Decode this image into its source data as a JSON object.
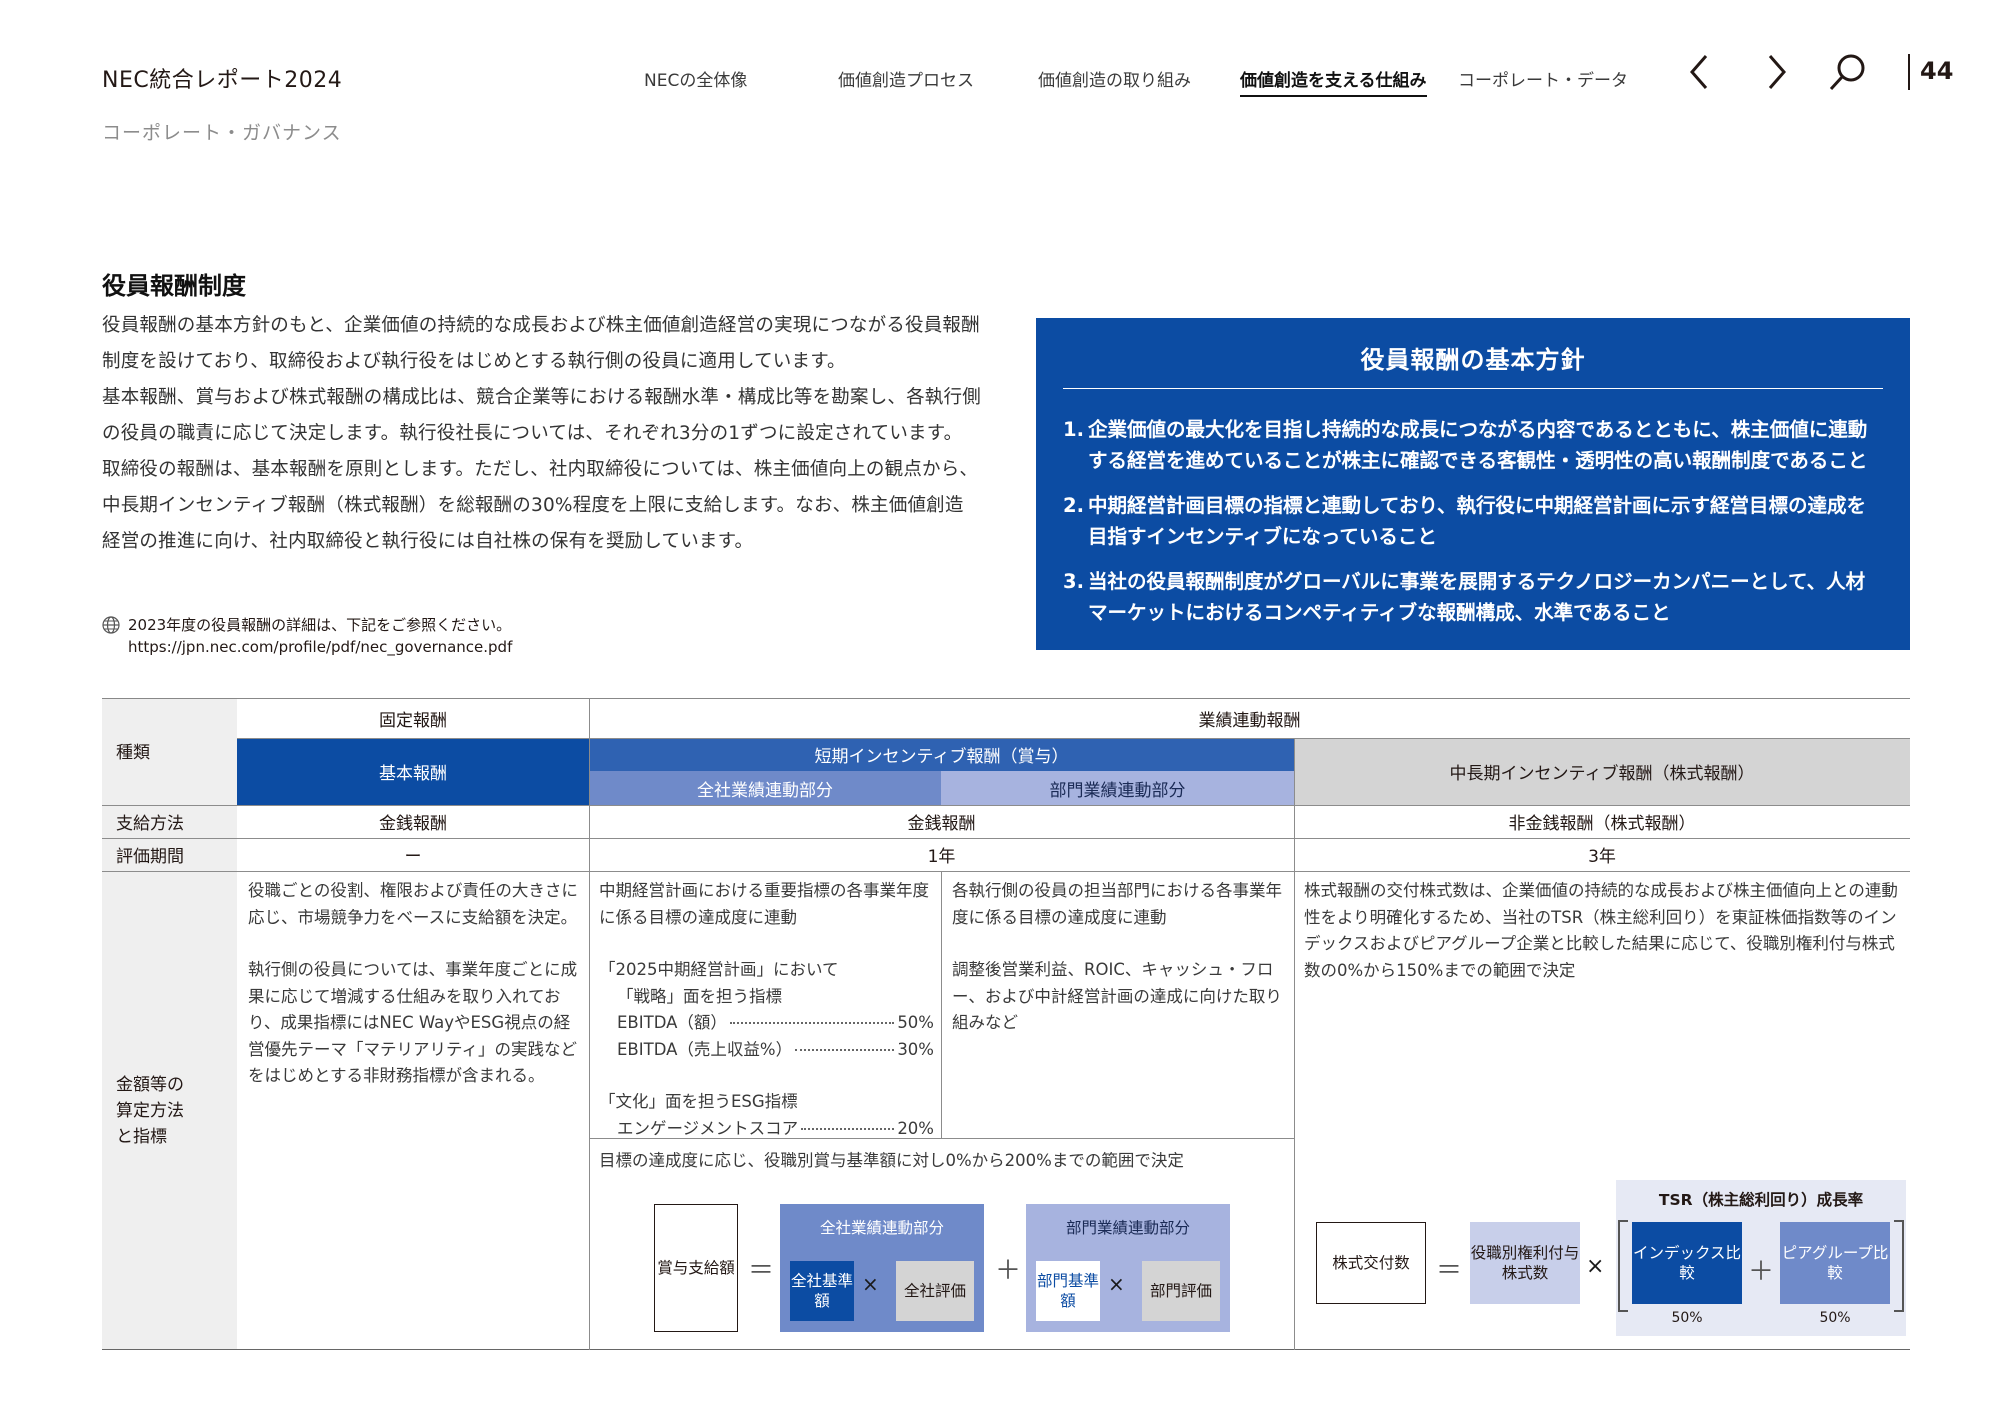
{
  "header": {
    "report_title": "NEC統合レポート2024",
    "breadcrumb": "コーポレート・ガバナンス",
    "nav": [
      {
        "label": "NECの全体像"
      },
      {
        "label": "価値創造プロセス"
      },
      {
        "label": "価値創造の取り組み"
      },
      {
        "label": "価値創造を支える仕組み"
      },
      {
        "label": "コーポレート・データ"
      }
    ],
    "page_number": "44"
  },
  "section": {
    "title": "役員報酬制度",
    "paragraphs": [
      "役員報酬の基本方針のもと、企業価値の持続的な成長および株主価値創造経営の実現につながる役員報酬制度を設けており、取締役および執行役をはじめとする執行側の役員に適用しています。",
      "基本報酬、賞与および株式報酬の構成比は、競合企業等における報酬水準・構成比等を勘案し、各執行側の役員の職責に応じて決定します。執行役社長については、それぞれ3分の1ずつに設定されています。",
      "取締役の報酬は、基本報酬を原則とします。ただし、社内取締役については、株主価値向上の観点から、中長期インセンティブ報酬（株式報酬）を総報酬の30%程度を上限に支給します。なお、株主価値創造経営の推進に向け、社内取締役と執行役には自社株の保有を奨励しています。"
    ],
    "note": "2023年度の役員報酬の詳細は、下記をご参照ください。",
    "note_url": "https://jpn.nec.com/profile/pdf/nec_governance.pdf"
  },
  "policy": {
    "title": "役員報酬の基本方針",
    "items": [
      {
        "num": "1.",
        "text": "企業価値の最大化を目指し持続的な成長につながる内容であるとともに、株主価値に連動する経営を進めていることが株主に確認できる客観性・透明性の高い報酬制度であること"
      },
      {
        "num": "2.",
        "text": "中期経営計画目標の指標と連動しており、執行役に中期経営計画に示す経営目標の達成を目指すインセンティブになっていること"
      },
      {
        "num": "3.",
        "text": "当社の役員報酬制度がグローバルに事業を展開するテクノロジーカンパニーとして、人材マーケットにおけるコンペティティブな報酬構成、水準であること"
      }
    ]
  },
  "table": {
    "row_labels": {
      "type": "種類",
      "payment": "支給方法",
      "period": "評価期間",
      "method": "金額等の算定方法と指標"
    },
    "fixed": "固定報酬",
    "performance": "業績連動報酬",
    "base": "基本報酬",
    "short_term": "短期インセンティブ報酬（賞与）",
    "company_part": "全社業績連動部分",
    "division_part": "部門業績連動部分",
    "long_term": "中長期インセンティブ報酬（株式報酬）",
    "payment_base": "金銭報酬",
    "payment_short": "金銭報酬",
    "payment_long": "非金銭報酬（株式報酬）",
    "period_base": "ー",
    "period_short": "1年",
    "period_long": "3年",
    "base_text_1": "役職ごとの役割、権限および責任の大きさに応じ、市場競争力をベースに支給額を決定。",
    "base_text_2": "執行側の役員については、事業年度ごとに成果に応じて増減する仕組みを取り入れており、成果指標にはNEC WayやESG視点の経営優先テーマ「マテリアリティ」の実践などをはじめとする非財務指標が含まれる。",
    "company_text_1": "中期経営計画における重要指標の各事業年度に係る目標の達成度に連動",
    "company_text_2": "「2025中期経営計画」において",
    "company_text_3": "「戦略」面を担う指標",
    "metrics": [
      {
        "label": "EBITDA（額）",
        "value": "50%"
      },
      {
        "label": "EBITDA（売上収益%）",
        "value": "30%"
      }
    ],
    "company_text_4": "「文化」面を担うESG指標",
    "metric_esg": {
      "label": "エンゲージメントスコア",
      "value": "20%"
    },
    "division_text_1": "各執行側の役員の担当部門における各事業年度に係る目標の達成度に連動",
    "division_text_2": "調整後営業利益、ROIC、キャッシュ・フロー、および中計経営計画の達成に向けた取り組みなど",
    "bonus_range": "目標の達成度に応じ、役職別賞与基準額に対し0%から200%までの範囲で決定",
    "long_text": "株式報酬の交付株式数は、企業価値の持続的な成長および株主価値向上との連動性をより明確化するため、当社のTSR（株主総利回り）を東証株価指数等のインデックスおよびピアグループ企業と比較した結果に応じて、役職別権利付与株式数の0%から150%までの範囲で決定"
  },
  "formula_bonus": {
    "result": "賞与支給額",
    "eq": "＝",
    "company_title": "全社業績連動部分",
    "company_base": "全社基準額",
    "company_eval": "全社評価",
    "times": "×",
    "plus": "＋",
    "division_title": "部門業績連動部分",
    "division_base": "部門基準額",
    "division_eval": "部門評価"
  },
  "formula_stock": {
    "result": "株式交付数",
    "eq": "＝",
    "grant": "役職別権利付与株式数",
    "times": "×",
    "tsr_title": "TSR（株主総利回り）成長率",
    "index": "インデックス比較",
    "plus": "＋",
    "peer": "ピアグループ比較",
    "index_weight": "50%",
    "peer_weight": "50%"
  },
  "colors": {
    "primary_blue": "#0c4ca3",
    "mid_blue": "#2f62b2",
    "light_blue": "#6f8ac9",
    "pale_blue": "#a7b3df",
    "gray": "#d4d4d4"
  }
}
